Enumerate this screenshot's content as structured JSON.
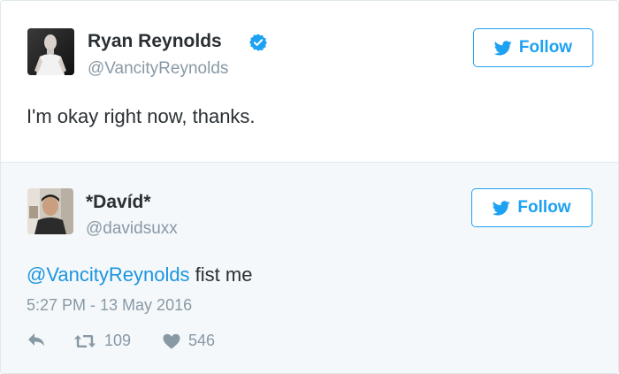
{
  "tweet": {
    "author_name": "Ryan Reynolds",
    "author_handle": "@VancityReynolds",
    "verified": true,
    "follow_label": "Follow",
    "text": "I'm okay right now, thanks."
  },
  "reply": {
    "author_name": "*Davíd*",
    "author_handle": "@davidsuxx",
    "follow_label": "Follow",
    "mention": "@VancityReynolds",
    "text": " fist me",
    "timestamp": "5:27 PM - 13 May 2016",
    "retweet_count": "109",
    "like_count": "546"
  },
  "colors": {
    "brand_blue": "#1da1f2",
    "link_blue": "#1b95e0",
    "muted_gray": "#8899a6"
  },
  "icons": [
    "verified-badge-icon",
    "twitter-bird-icon",
    "reply-icon",
    "retweet-icon",
    "heart-icon"
  ]
}
